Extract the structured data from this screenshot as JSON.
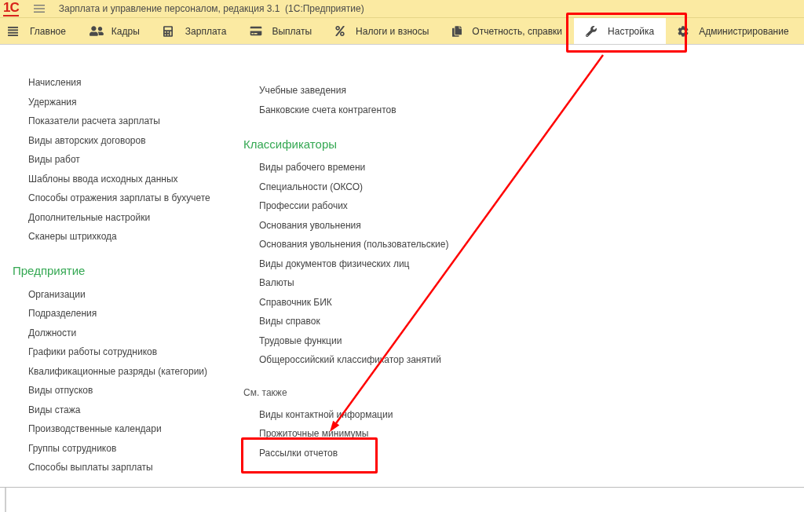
{
  "window": {
    "logo": "1С",
    "title": "Зарплата и управление персоналом, редакция 3.1  (1С:Предприятие)"
  },
  "tabs": [
    {
      "label": "Главное",
      "selected": false,
      "highlighted": false
    },
    {
      "label": "Кадры",
      "selected": false,
      "highlighted": false
    },
    {
      "label": "Зарплата",
      "selected": false,
      "highlighted": false
    },
    {
      "label": "Выплаты",
      "selected": false,
      "highlighted": false
    },
    {
      "label": "Налоги и взносы",
      "selected": false,
      "highlighted": false
    },
    {
      "label": "Отчетность, справки",
      "selected": false,
      "highlighted": false
    },
    {
      "label": "Настройка",
      "selected": true,
      "highlighted": true
    },
    {
      "label": "Администрирование",
      "selected": false,
      "highlighted": false
    }
  ],
  "columns": [
    {
      "groups": [
        {
          "kind": "untitled",
          "items": [
            {
              "label": "Начисления",
              "highlighted": false
            },
            {
              "label": "Удержания",
              "highlighted": false
            },
            {
              "label": "Показатели расчета зарплаты",
              "highlighted": false
            },
            {
              "label": "Виды авторских договоров",
              "highlighted": false
            },
            {
              "label": "Виды работ",
              "highlighted": false
            },
            {
              "label": "Шаблоны ввода исходных данных",
              "highlighted": false
            },
            {
              "label": "Способы отражения зарплаты в бухучете",
              "highlighted": false
            },
            {
              "label": "Дополнительные настройки",
              "highlighted": false
            },
            {
              "label": "Сканеры штрихкода",
              "highlighted": false
            }
          ]
        },
        {
          "kind": "section",
          "title": "Предприятие",
          "items": [
            {
              "label": "Организации",
              "highlighted": false
            },
            {
              "label": "Подразделения",
              "highlighted": false
            },
            {
              "label": "Должности",
              "highlighted": false
            },
            {
              "label": "Графики работы сотрудников",
              "highlighted": false
            },
            {
              "label": "Квалификационные разряды (категории)",
              "highlighted": false
            },
            {
              "label": "Виды отпусков",
              "highlighted": false
            },
            {
              "label": "Виды стажа",
              "highlighted": false
            },
            {
              "label": "Производственные календари",
              "highlighted": false
            },
            {
              "label": "Группы сотрудников",
              "highlighted": false
            },
            {
              "label": "Способы выплаты зарплаты",
              "highlighted": false
            }
          ]
        }
      ]
    },
    {
      "groups": [
        {
          "kind": "untitled",
          "items": [
            {
              "label": "Учебные заведения",
              "highlighted": false
            },
            {
              "label": "Банковские счета контрагентов",
              "highlighted": false
            }
          ]
        },
        {
          "kind": "section",
          "title": "Классификаторы",
          "items": [
            {
              "label": "Виды рабочего времени",
              "highlighted": false
            },
            {
              "label": "Специальности (ОКСО)",
              "highlighted": false
            },
            {
              "label": "Профессии рабочих",
              "highlighted": false
            },
            {
              "label": "Основания увольнения",
              "highlighted": false
            },
            {
              "label": "Основания увольнения (пользовательские)",
              "highlighted": false
            },
            {
              "label": "Виды документов физических лиц",
              "highlighted": false
            },
            {
              "label": "Валюты",
              "highlighted": false
            },
            {
              "label": "Справочник БИК",
              "highlighted": false
            },
            {
              "label": "Виды справок",
              "highlighted": false
            },
            {
              "label": "Трудовые функции",
              "highlighted": false
            },
            {
              "label": "Общероссийский классификатор занятий",
              "highlighted": false
            }
          ]
        },
        {
          "kind": "see_also",
          "title": "См. также",
          "items": [
            {
              "label": "Виды контактной информации",
              "highlighted": false
            },
            {
              "label": "Прожиточные минимумы",
              "highlighted": false
            },
            {
              "label": "Рассылки отчетов",
              "highlighted": true
            }
          ]
        }
      ]
    }
  ]
}
